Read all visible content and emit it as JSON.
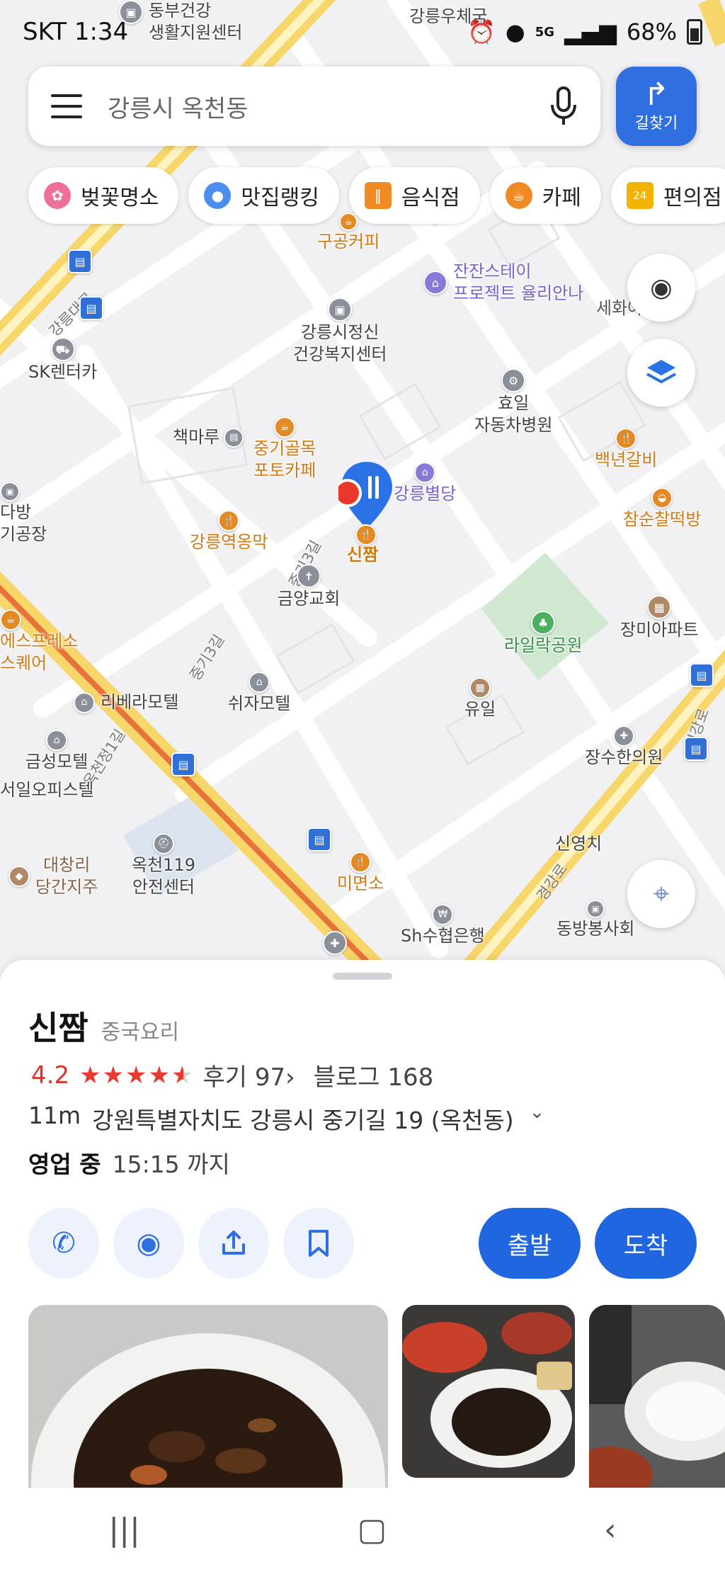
{
  "status_bar": {
    "carrier_time": "SKT 1:34",
    "battery": "68%",
    "network": "5G"
  },
  "search": {
    "text": "강릉시 옥천동"
  },
  "route_button": {
    "label": "길찾기"
  },
  "chips": [
    {
      "label": "벚꽃명소",
      "icon": "cherry-blossom-icon",
      "color": "#ef6f9b"
    },
    {
      "label": "맛집랭킹",
      "icon": "ranking-pin-icon",
      "color": "#4b8ef0"
    },
    {
      "label": "음식점",
      "icon": "utensils-icon",
      "color": "#f08a24"
    },
    {
      "label": "카페",
      "icon": "coffee-cup-icon",
      "color": "#f08a24"
    },
    {
      "label": "편의점",
      "icon": "convenience-24-icon",
      "color": "#f3b300"
    }
  ],
  "map_pois": {
    "dongbu": "동부건강\n생활지원센터",
    "post": "강릉우체국",
    "gugong": "구공커피",
    "jjanjan": "잔잔스테이\n프로젝트 율리안나",
    "health": "강릉시정신\n건강복지센터",
    "sk": "SK렌터카",
    "sehwa": "세화아파트",
    "hyoil": "효일\n자동차병원",
    "chaekmaru": "책마루",
    "junggi": "중기골목\n포토카페",
    "baeknyeon": "백년갈비",
    "gangneung_byeol": "강릉별당",
    "chamsun": "참순찰떡방",
    "yeokong": "강릉역옹막",
    "sinjjam_label": "신짬",
    "geumyang": "금양교회",
    "lailak": "라일락공원",
    "jangmi": "장미아파트",
    "dabang": "다방\n기공장",
    "espresso": "에스프레소\n스퀘어",
    "riviera": "리베라모텔",
    "shija": "쉬자모텔",
    "yuil": "유일",
    "geumseong": "금성모텔",
    "seoil": "서일오피스텔",
    "jangsu": "장수한의원",
    "daechang": "대창리\n당간지주",
    "okcheon119": "옥천119\n안전센터",
    "myeonso": "미면소",
    "sinyoung": "신영치",
    "sh": "Sh수협은행",
    "dongbang": "동방봉사회"
  },
  "road_labels": {
    "gangneungdaero": "강릉대로",
    "junggi3": "중기3길",
    "junggi3b": "중기3길",
    "okcheonjeong": "옥천정1길",
    "gyeonggang": "경강로",
    "gyeonggang2": "경강로"
  },
  "place": {
    "name": "신짬",
    "category": "중국요리",
    "rating": "4.2",
    "rating_value": 4.2,
    "reviews": "후기 97",
    "blog": "블로그 168",
    "distance": "11m",
    "address": "강원특별자치도 강릉시 중기길 19 (옥천동)",
    "open_status": "영업 중",
    "close_time": "15:15 까지",
    "depart": "출발",
    "arrive": "도착"
  }
}
